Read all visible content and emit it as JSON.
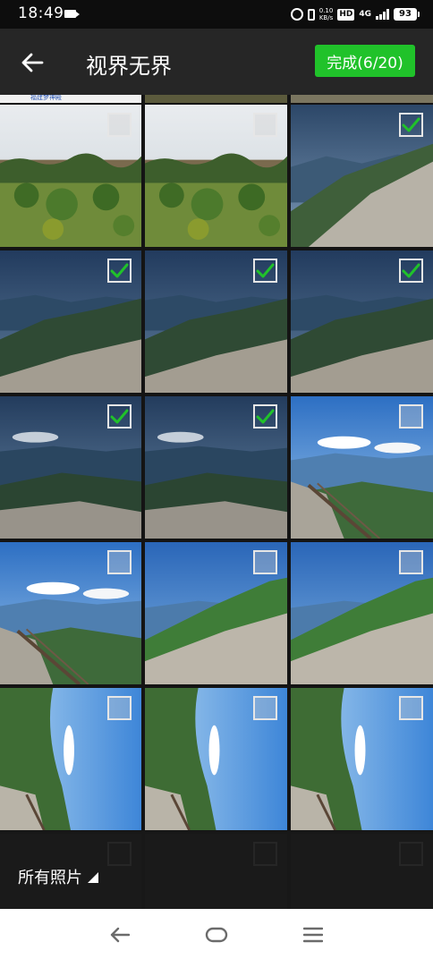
{
  "status_bar": {
    "time": "18:49",
    "net_speed_value": "0.10",
    "net_speed_unit": "KB/s",
    "hd_label": "HD",
    "network_type": "4G",
    "battery_level": "93"
  },
  "header": {
    "title": "视界无界",
    "done_label": "完成(6/20)",
    "selected_count": 6,
    "max_count": 20
  },
  "photo_grid": {
    "partial_top_caption": "福建梦神殿",
    "photos": [
      {
        "scene": "orchard",
        "selected": false
      },
      {
        "scene": "orchard",
        "selected": false
      },
      {
        "scene": "slope",
        "selected": true
      },
      {
        "scene": "valley",
        "selected": true
      },
      {
        "scene": "valley",
        "selected": true
      },
      {
        "scene": "valley",
        "selected": true
      },
      {
        "scene": "ridge",
        "selected": true
      },
      {
        "scene": "ridge",
        "selected": true
      },
      {
        "scene": "boardwalk",
        "selected": false
      },
      {
        "scene": "boardwalk",
        "selected": false
      },
      {
        "scene": "green-slope",
        "selected": false
      },
      {
        "scene": "green-slope",
        "selected": false
      },
      {
        "scene": "rotated",
        "selected": false
      },
      {
        "scene": "rotated",
        "selected": false
      },
      {
        "scene": "rotated",
        "selected": false
      },
      {
        "scene": "dark",
        "selected": false
      },
      {
        "scene": "dark",
        "selected": false
      },
      {
        "scene": "dark",
        "selected": false
      }
    ]
  },
  "footer": {
    "album_label": "所有照片"
  },
  "colors": {
    "accent_green": "#20c22a",
    "title_bar": "#262626",
    "status_bar": "#0d0d0d"
  }
}
